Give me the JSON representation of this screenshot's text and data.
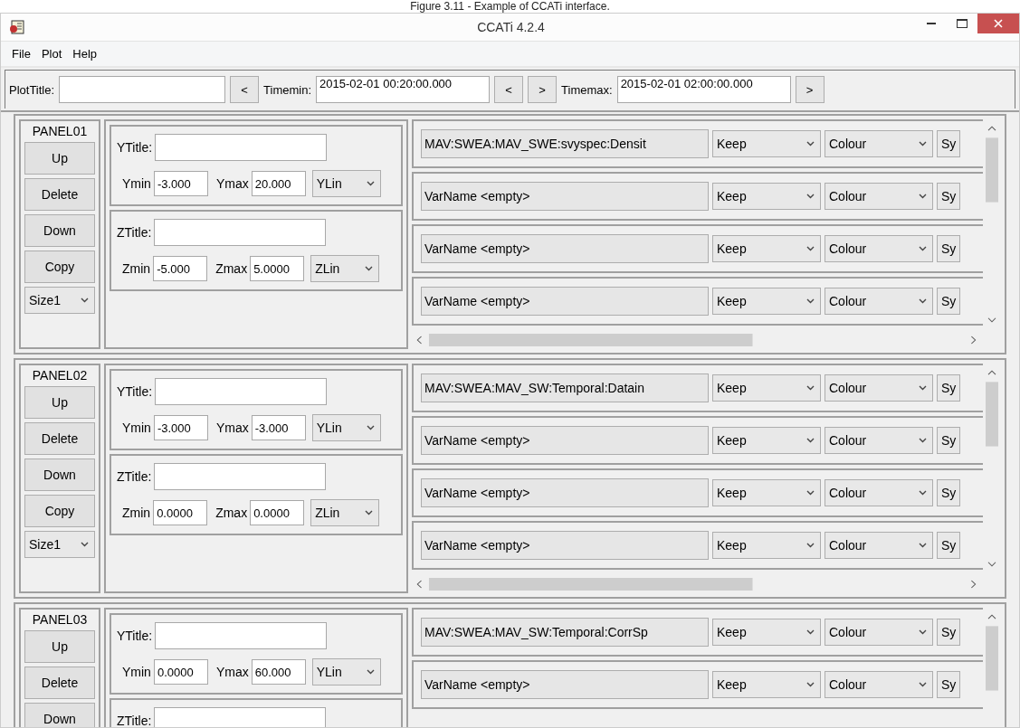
{
  "caption": "Figure 3.11 - Example of CCATi interface.",
  "window": {
    "title": "CCATi 4.2.4"
  },
  "menu": [
    "File",
    "Plot",
    "Help"
  ],
  "toolbar": [
    {
      "kind": "label",
      "text": "PlotTitle:"
    },
    {
      "kind": "field"
    },
    {
      "kind": "button",
      "text": "<"
    },
    {
      "kind": "label",
      "text": "Timemin:"
    },
    {
      "kind": "field",
      "text": "2015-02-01 00:20:00.000"
    },
    {
      "kind": "button",
      "text": "<"
    },
    {
      "kind": "button",
      "text": ">"
    },
    {
      "kind": "label",
      "text": "Timemax:"
    },
    {
      "kind": "field",
      "text": "2015-02-01 02:00:00.000"
    },
    {
      "kind": "button",
      "text": ">"
    }
  ],
  "panels": [
    {
      "name": "PANEL01",
      "buttons": [
        "Up",
        "Delete",
        "Down",
        "Copy"
      ],
      "size": "Size1",
      "ytitle_label": "YTitle:",
      "ymin_label": "Ymin",
      "ymin": "-3.000",
      "ymax_label": "Ymax",
      "ymax": "20.000",
      "yscale": "YLin",
      "ztitle_label": "ZTitle:",
      "zmin_label": "Zmin",
      "zmin": "-5.000",
      "zmax_label": "Zmax",
      "zmax": "5.0000",
      "zscale": "ZLin",
      "variables": [
        {
          "name": "MAV:SWEA:MAV_SWE:svyspec:Densit",
          "mode": "Keep",
          "colour": "Colour",
          "column_4": "Sy"
        },
        {
          "name": "VarName <empty>",
          "mode": "Keep",
          "colour": "Colour",
          "column_4": "Sy"
        },
        {
          "name": "VarName <empty>",
          "mode": "Keep",
          "colour": "Colour",
          "column_4": "Sy"
        },
        {
          "name": "VarName <empty>",
          "mode": "Keep",
          "colour": "Colour",
          "column_4": "Sy"
        }
      ]
    },
    {
      "name": "PANEL02",
      "buttons": [
        "Up",
        "Delete",
        "Down",
        "Copy"
      ],
      "size": "Size1",
      "ytitle_label": "YTitle:",
      "ymin_label": "Ymin",
      "ymin": "-3.000",
      "ymax_label": "Ymax",
      "ymax": "-3.000",
      "yscale": "YLin",
      "ztitle_label": "ZTitle:",
      "zmin_label": "Zmin",
      "zmin": "0.0000",
      "zmax_label": "Zmax",
      "zmax": "0.0000",
      "zscale": "ZLin",
      "variables": [
        {
          "name": "MAV:SWEA:MAV_SW:Temporal:Datain",
          "mode": "Keep",
          "colour": "Colour",
          "column_4": "Sy"
        },
        {
          "name": "VarName <empty>",
          "mode": "Keep",
          "colour": "Colour",
          "column_4": "Sy"
        },
        {
          "name": "VarName <empty>",
          "mode": "Keep",
          "colour": "Colour",
          "column_4": "Sy"
        },
        {
          "name": "VarName <empty>",
          "mode": "Keep",
          "colour": "Colour",
          "column_4": "Sy"
        }
      ]
    },
    {
      "name": "PANEL03",
      "buttons": [
        "Up",
        "Delete",
        "Down"
      ],
      "ytitle_label": "YTitle:",
      "ymin_label": "Ymin",
      "ymin": "0.0000",
      "ymax_label": "Ymax",
      "ymax": "60.000",
      "yscale": "YLin",
      "ztitle_label": "ZTitle:",
      "variables": [
        {
          "name": "MAV:SWEA:MAV_SW:Temporal:CorrSp",
          "mode": "Keep",
          "colour": "Colour",
          "column_4": "Sy"
        },
        {
          "name": "VarName <empty>",
          "mode": "Keep",
          "colour": "Colour",
          "column_4": "Sy"
        }
      ]
    }
  ]
}
